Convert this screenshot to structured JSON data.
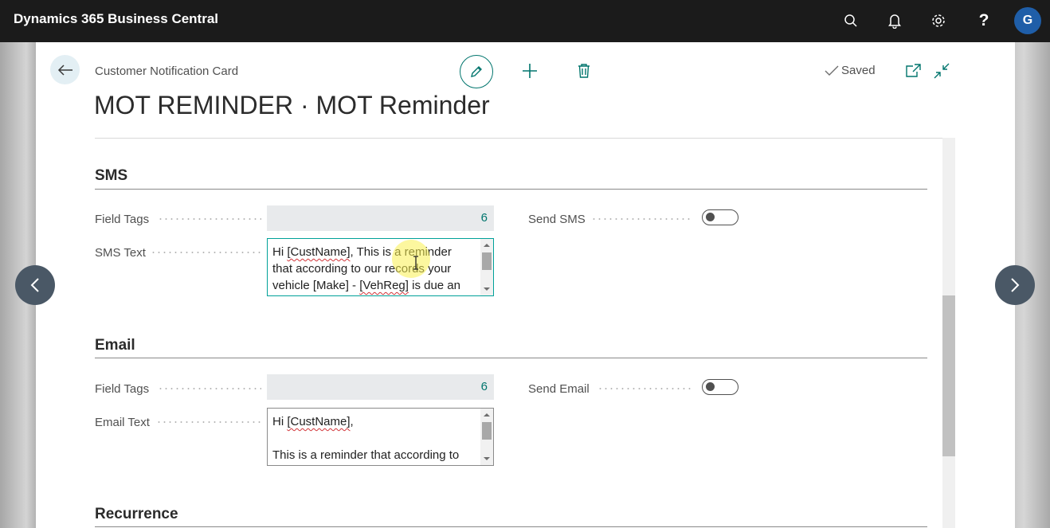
{
  "topbar": {
    "app_title": "Dynamics 365 Business Central",
    "icons": [
      "search-icon",
      "bell-icon",
      "gear-icon",
      "help-icon"
    ],
    "user_initial": "G"
  },
  "card": {
    "breadcrumb": "Customer Notification Card",
    "title": "MOT REMINDER · MOT Reminder",
    "saved_label": "Saved"
  },
  "sms": {
    "section_title": "SMS",
    "field_tags_label": "Field Tags",
    "field_tags_value": "6",
    "text_label": "SMS Text",
    "send_label": "Send SMS",
    "send_enabled": false,
    "text_value": {
      "line1_pre": "Hi ",
      "line1_tag": "[CustName]",
      "line1_post": ", This is a reminder",
      "line2": "that according to our records your",
      "line3_pre": "vehicle [Make] - ",
      "line3_tag": "[VehReg]",
      "line3_post": " is due an"
    }
  },
  "email": {
    "section_title": "Email",
    "field_tags_label": "Field Tags",
    "field_tags_value": "6",
    "text_label": "Email Text",
    "send_label": "Send Email",
    "send_enabled": false,
    "text_value": {
      "line1_pre": "Hi ",
      "line1_tag": "[CustName]",
      "line1_post": ",",
      "line3": "This is a reminder that according to"
    }
  },
  "recurrence": {
    "section_title": "Recurrence"
  },
  "colors": {
    "accent": "#00756d",
    "topbar": "#1b1b1b",
    "avatar": "#1f5ea8"
  }
}
